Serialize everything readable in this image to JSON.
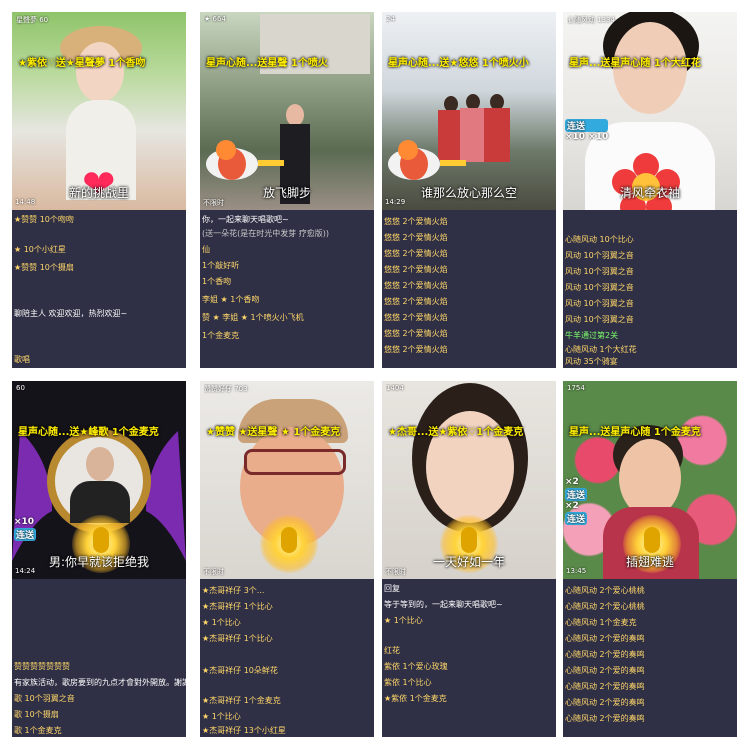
{
  "tiles": [
    {
      "top_text": "星聲夢  60",
      "banner": "★紫依♡送★星聲夢 1个香吻",
      "caption": "新的挑战里",
      "time": "14:48",
      "chat": [
        {
          "text": "★赞赞  10个吻吻",
          "style": "yellow"
        },
        {
          "text": "★ 10个小红星",
          "style": "yellow"
        },
        {
          "text": "★赞赞  10个摄扇",
          "style": "yellow"
        },
        {
          "text": "聊陪主人 欢迎欢迎，热烈欢迎~",
          "style": "white"
        },
        {
          "text": "歌唱",
          "style": "yellow"
        }
      ]
    },
    {
      "top_text": "★ 664",
      "banner": "星声心随...送星聲 1个喷火",
      "caption": "放飞脚步",
      "time": "不限时",
      "chat": [
        {
          "text": "你，一起来聊天唱歌吧~",
          "style": "white"
        },
        {
          "text": "(送一朵花(是在时光中发芽 疗愈版))",
          "style": "grey"
        },
        {
          "text": "仙",
          "style": "yellow"
        },
        {
          "text": "1个敲好听",
          "style": "yellow"
        },
        {
          "text": "1个香吻",
          "style": "yellow"
        },
        {
          "text": "李姐 ★ 1个香吻",
          "style": "yellow"
        },
        {
          "text": "赞 ★ 李姐 ★ 1个喷火小飞机",
          "style": "yellow"
        },
        {
          "text": "1个金麦克",
          "style": "yellow"
        }
      ]
    },
    {
      "top_text": "24",
      "banner": "星声心随...送★悠悠 1个喷火小",
      "caption": "谁那么放心那么空",
      "time": "14:29",
      "chat": [
        {
          "text": "悠悠 2个爱情火焰",
          "style": "yellow"
        },
        {
          "text": "悠悠 2个爱情火焰",
          "style": "yellow"
        },
        {
          "text": "悠悠 2个爱情火焰",
          "style": "yellow"
        },
        {
          "text": "悠悠 2个爱情火焰",
          "style": "yellow"
        },
        {
          "text": "悠悠 2个爱情火焰",
          "style": "yellow"
        },
        {
          "text": "悠悠 2个爱情火焰",
          "style": "yellow"
        },
        {
          "text": "悠悠 2个爱情火焰",
          "style": "yellow"
        },
        {
          "text": "悠悠 2个爱情火焰",
          "style": "yellow"
        },
        {
          "text": "悠悠 2个爱情火焰",
          "style": "yellow"
        }
      ]
    },
    {
      "top_text": "心随风动 1334",
      "banner": "星声...送星声心随 1个大红花",
      "caption": "清风牵衣袖",
      "time": "",
      "chat": [
        {
          "text": "心随风动 10个比心",
          "style": "yellow"
        },
        {
          "text": "风动 10个羽翼之音",
          "style": "yellow"
        },
        {
          "text": "风动 10个羽翼之音",
          "style": "yellow"
        },
        {
          "text": "风动 10个羽翼之音",
          "style": "yellow"
        },
        {
          "text": "风动 10个羽翼之音",
          "style": "yellow"
        },
        {
          "text": "风动 10个羽翼之音",
          "style": "yellow"
        },
        {
          "text": "牛羊通过第2关",
          "style": "green"
        },
        {
          "text": "心随风动 1个大红花",
          "style": "yellow"
        },
        {
          "text": "风动 35个骑宴",
          "style": "yellow"
        }
      ]
    },
    {
      "top_text": "60",
      "banner": "星声心随...送★峰歌 1个金麦克",
      "caption": "男:你早就该拒绝我",
      "time": "14:24",
      "chat": [
        {
          "text": "赞赞赞赞赞赞赞",
          "style": "yellow"
        },
        {
          "text": "有家族活动，歌房要到的九点才會對外開放。謝謝你",
          "style": "white"
        },
        {
          "text": "歌 10个羽翼之音",
          "style": "yellow"
        },
        {
          "text": "歌 10个摄扇",
          "style": "yellow"
        },
        {
          "text": "歌 1个金麦克",
          "style": "yellow"
        }
      ]
    },
    {
      "top_text": "赞赞好仔 703",
      "banner": "★赞赞 ★送星聲 ★ 1个金麦克",
      "caption": "",
      "time": "不限时",
      "chat": [
        {
          "text": "★杰哥祥仔 3个...",
          "style": "yellow"
        },
        {
          "text": "★杰哥祥仔 1个比心",
          "style": "yellow"
        },
        {
          "text": "★ 1个比心",
          "style": "yellow"
        },
        {
          "text": "★杰哥祥仔 1个比心",
          "style": "yellow"
        },
        {
          "text": "★杰哥祥仔 10朵鲜花",
          "style": "yellow"
        },
        {
          "text": "★杰哥祥仔 1个金麦克",
          "style": "yellow"
        },
        {
          "text": "★ 1个比心",
          "style": "yellow"
        },
        {
          "text": "★杰哥祥仔 13个小红星",
          "style": "yellow"
        }
      ]
    },
    {
      "top_text": "1404",
      "banner": "★杰哥...送★紫依♡1个金麦克",
      "caption": "一天好如一年",
      "time": "不限时",
      "chat": [
        {
          "text": "回复",
          "style": "white"
        },
        {
          "text": "等于等到的，一起来聊天唱歌吧~",
          "style": "white"
        },
        {
          "text": "★ 1个比心",
          "style": "yellow"
        },
        {
          "text": "红花",
          "style": "yellow"
        },
        {
          "text": "紫依 1个爱心玫瑰",
          "style": "yellow"
        },
        {
          "text": "紫依 1个比心",
          "style": "yellow"
        },
        {
          "text": "★紫依 1个金麦克",
          "style": "yellow"
        }
      ]
    },
    {
      "top_text": "1754",
      "banner": "星声...送星声心随 1个金麦克",
      "caption": "插翅难逃",
      "time": "13:45",
      "chat": [
        {
          "text": "心随风动 2个爱心桃桃",
          "style": "yellow"
        },
        {
          "text": "心随风动 2个爱心桃桃",
          "style": "yellow"
        },
        {
          "text": "心随风动 1个金麦克",
          "style": "yellow"
        },
        {
          "text": "心随风动 2个爱的奏鸣",
          "style": "yellow"
        },
        {
          "text": "心随风动 2个爱的奏鸣",
          "style": "yellow"
        },
        {
          "text": "心随风动 2个爱的奏鸣",
          "style": "yellow"
        },
        {
          "text": "心随风动 2个爱的奏鸣",
          "style": "yellow"
        },
        {
          "text": "心随风动 2个爱的奏鸣",
          "style": "yellow"
        },
        {
          "text": "心随风动 2个爱的奏鸣",
          "style": "yellow"
        }
      ]
    }
  ],
  "combos": [
    {
      "tile": 3,
      "count1": "×10",
      "lian": "连送",
      "count2": "×10"
    },
    {
      "tile": 4,
      "count1": "×10",
      "lian": "连送"
    },
    {
      "tile": 7,
      "count1": "×2",
      "lian": "连送",
      "count2": "×2",
      "lian2": "连送"
    }
  ]
}
